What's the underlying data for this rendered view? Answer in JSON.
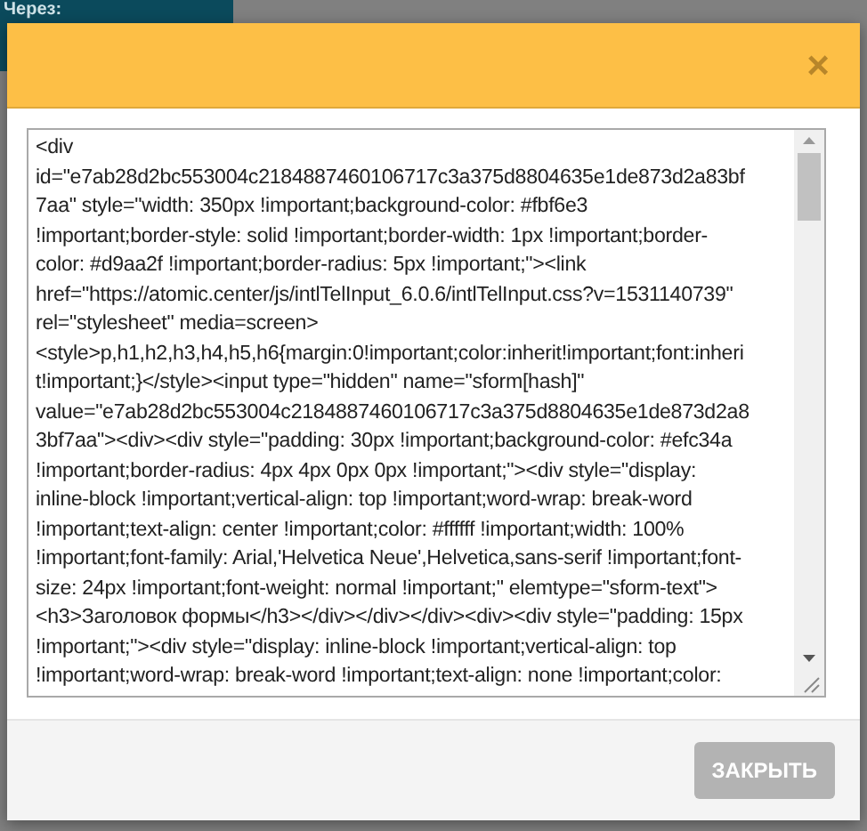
{
  "background": {
    "label": "Через:"
  },
  "dialog": {
    "close": "×",
    "code_lines": [
      "<div",
      "id=\"e7ab28d2bc553004c2184887460106717c3a375d8804635e1de873d2a83bf",
      "7aa\" style=\"width: 350px !important;background-color: #fbf6e3",
      "!important;border-style: solid !important;border-width: 1px !important;border-",
      "color: #d9aa2f !important;border-radius: 5px !important;\"><link",
      "href=\"https://atomic.center/js/intlTelInput_6.0.6/intlTelInput.css?v=1531140739\"",
      "rel=\"stylesheet\" media=screen>",
      "<style>p,h1,h2,h3,h4,h5,h6{margin:0!important;color:inherit!important;font:inheri",
      "t!important;}</style><input type=\"hidden\" name=\"sform[hash]\"",
      "value=\"e7ab28d2bc553004c2184887460106717c3a375d8804635e1de873d2a8",
      "3bf7aa\"><div><div style=\"padding: 30px !important;background-color: #efc34a",
      "!important;border-radius: 4px 4px 0px 0px !important;\"><div style=\"display:",
      "inline-block !important;vertical-align: top !important;word-wrap: break-word",
      "!important;text-align: center !important;color: #ffffff !important;width: 100%",
      "!important;font-family: Arial,'Helvetica Neue',Helvetica,sans-serif !important;font-",
      "size: 24px !important;font-weight: normal !important;\" elemtype=\"sform-text\">",
      "<h3>Заголовок формы</h3></div></div></div><div><div style=\"padding: 15px",
      "!important;\"><div style=\"display: inline-block !important;vertical-align: top",
      "!important;word-wrap: break-word !important;text-align: none !important;color:"
    ],
    "button": {
      "label": "ЗАКРЫТЬ",
      "disabled": true
    }
  }
}
